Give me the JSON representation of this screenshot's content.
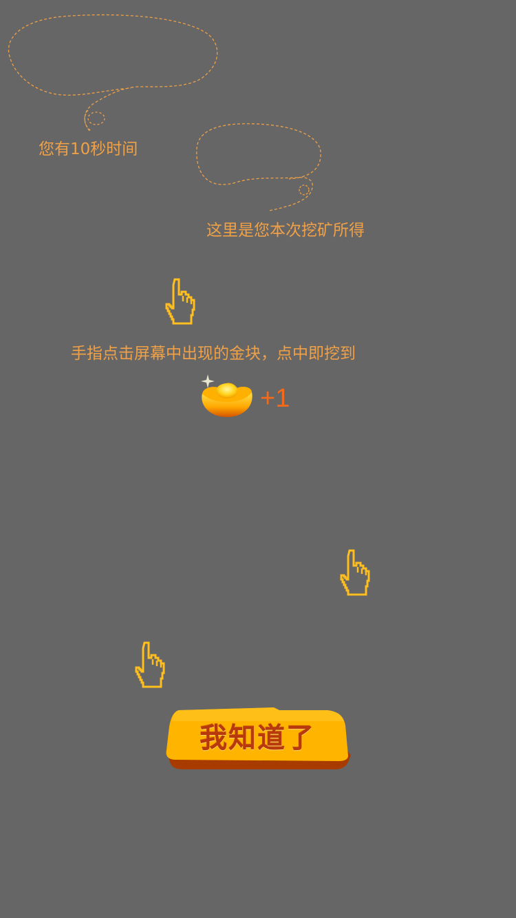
{
  "tutorial": {
    "timer_hint": "您有10秒时间",
    "earnings_hint": "这里是您本次挖矿所得",
    "instruction": "手指点击屏幕中出现的金块，点中即挖到"
  },
  "reward": {
    "icon": "gold-ingot-icon",
    "increment_label": "+1"
  },
  "confirm_button": {
    "label": "我知道了"
  },
  "colors": {
    "background": "#666666",
    "hint_text": "#f0a148",
    "increment_text": "#f26a1b",
    "button_fill": "#ffb400",
    "button_shadow": "#a83c00",
    "button_text": "#b83a0c",
    "hand_outline": "#ffbf1f"
  }
}
